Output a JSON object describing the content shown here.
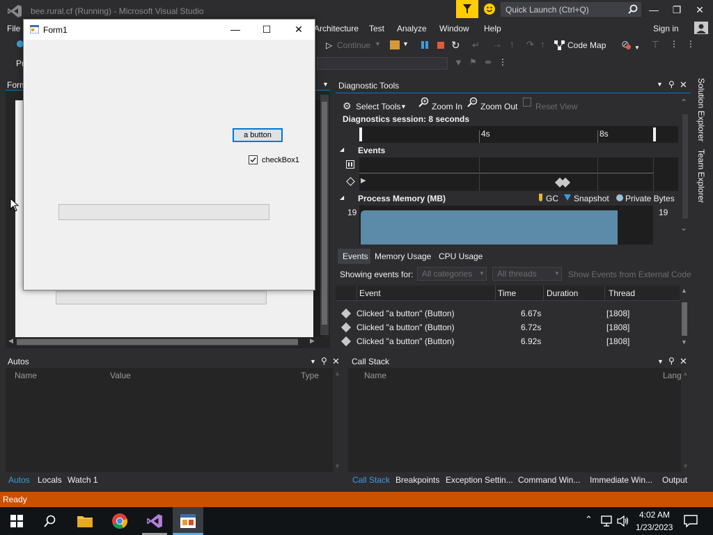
{
  "titlebar": {
    "title": "bee.rural.cf (Running) - Microsoft Visual Studio",
    "quick_launch_placeholder": "Quick Launch (Ctrl+Q)"
  },
  "menu": {
    "file": "File",
    "architecture": "Architecture",
    "test": "Test",
    "analyze": "Analyze",
    "window": "Window",
    "help": "Help",
    "sign_in": "Sign in"
  },
  "toolbar": {
    "continue": "Continue",
    "code_map": "Code Map",
    "partial_left": "Pr"
  },
  "designer": {
    "tab_label": "Form"
  },
  "form1": {
    "title": "Form1",
    "button_label": "a button",
    "checkbox_label": "checkBox1",
    "checkbox_checked": true
  },
  "diagnostic": {
    "title": "Diagnostic Tools",
    "select_tools": "Select Tools",
    "zoom_in": "Zoom In",
    "zoom_out": "Zoom Out",
    "reset_view": "Reset View",
    "session": "Diagnostics session: 8 seconds",
    "tick_4s": "4s",
    "tick_8s": "8s",
    "events_label": "Events",
    "memory_label": "Process Memory (MB)",
    "legend_gc": "GC",
    "legend_snapshot": "Snapshot",
    "legend_private": "Private Bytes",
    "mem_left": "19",
    "mem_right": "19",
    "tabs": [
      "Events",
      "Memory Usage",
      "CPU Usage"
    ],
    "showing_events_for": "Showing events for:",
    "all_categories": "All categories",
    "all_threads": "All threads",
    "show_external": "Show Events from External Code",
    "columns": [
      "Event",
      "Time",
      "Duration",
      "Thread"
    ],
    "rows": [
      {
        "event": "Clicked \"a button\" (Button)",
        "time": "6.67s",
        "duration": "",
        "thread": "[1808]"
      },
      {
        "event": "Clicked \"a button\" (Button)",
        "time": "6.72s",
        "duration": "",
        "thread": "[1808]"
      },
      {
        "event": "Clicked \"a button\" (Button)",
        "time": "6.92s",
        "duration": "",
        "thread": "[1808]"
      }
    ]
  },
  "autos": {
    "title": "Autos",
    "col_name": "Name",
    "col_value": "Value",
    "col_type": "Type",
    "tabs": [
      "Autos",
      "Locals",
      "Watch 1"
    ]
  },
  "callstack": {
    "title": "Call Stack",
    "col_name": "Name",
    "col_lang": "Lang",
    "tabs": [
      "Call Stack",
      "Breakpoints",
      "Exception Settin...",
      "Command Win...",
      "Immediate Win...",
      "Output"
    ]
  },
  "side_tabs": {
    "solution_explorer": "Solution Explorer",
    "team_explorer": "Team Explorer"
  },
  "status": {
    "text": "Ready"
  },
  "taskbar": {
    "time": "4:02 AM",
    "date": "1/23/2023"
  },
  "colors": {
    "status_bar": "#ca5100",
    "vs_dark": "#2d2d30",
    "accent_blue": "#3e9cdc",
    "memory_fill": "#5b8ba8"
  }
}
